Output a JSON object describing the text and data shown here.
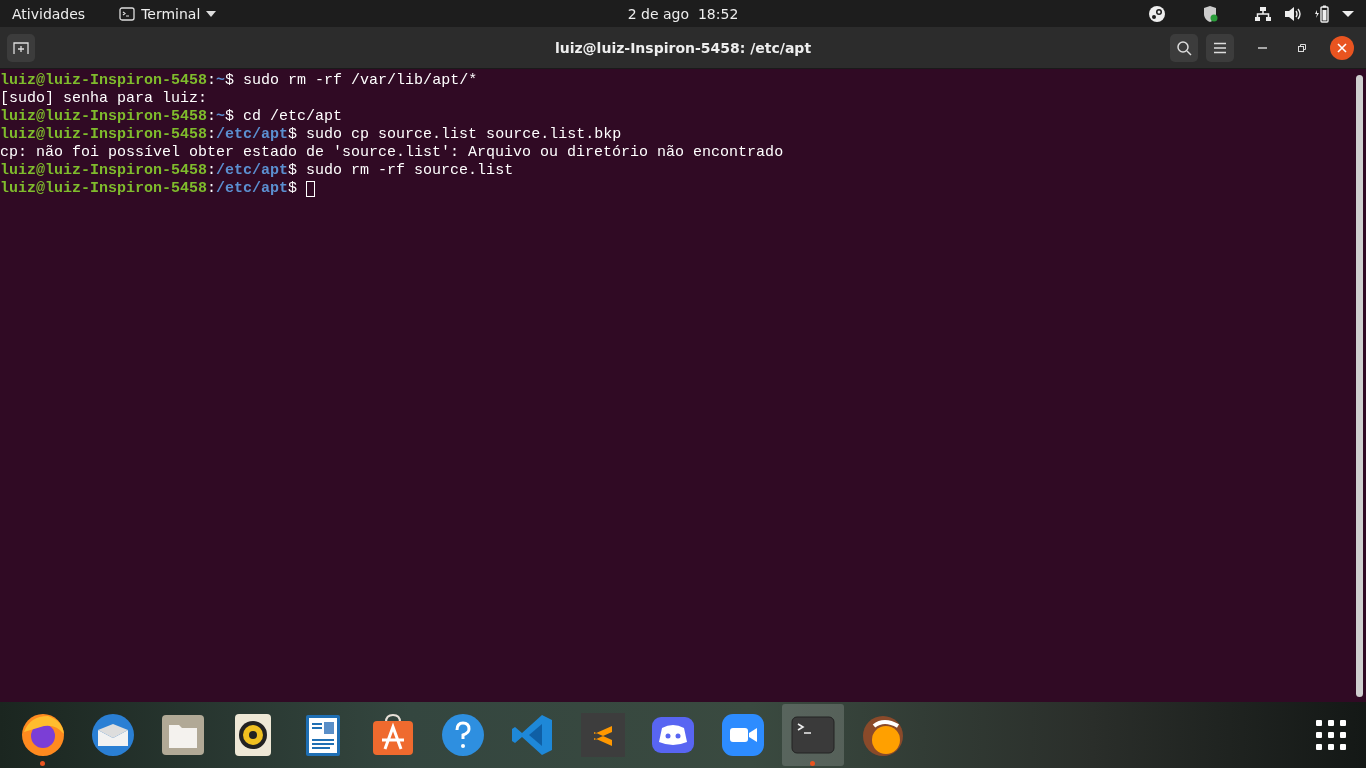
{
  "top_bar": {
    "activities": "Atividades",
    "app_menu": "Terminal",
    "clock": "2 de ago  18:52"
  },
  "window": {
    "title": "luiz@luiz-Inspiron-5458: /etc/apt"
  },
  "terminal_lines": [
    {
      "kind": "prompt",
      "user": "luiz@luiz-Inspiron-5458",
      "sep": ":",
      "path": "~",
      "sign": "$",
      "command": " sudo rm -rf /var/lib/apt/*",
      "cursor": false
    },
    {
      "kind": "output",
      "text": "[sudo] senha para luiz:"
    },
    {
      "kind": "prompt",
      "user": "luiz@luiz-Inspiron-5458",
      "sep": ":",
      "path": "~",
      "sign": "$",
      "command": " cd /etc/apt",
      "cursor": false
    },
    {
      "kind": "prompt",
      "user": "luiz@luiz-Inspiron-5458",
      "sep": ":",
      "path": "/etc/apt",
      "sign": "$",
      "command": " sudo cp source.list source.list.bkp",
      "cursor": false
    },
    {
      "kind": "output",
      "text": "cp: não foi possível obter estado de 'source.list': Arquivo ou diretório não encontrado"
    },
    {
      "kind": "prompt",
      "user": "luiz@luiz-Inspiron-5458",
      "sep": ":",
      "path": "/etc/apt",
      "sign": "$",
      "command": " sudo rm -rf source.list",
      "cursor": false
    },
    {
      "kind": "prompt",
      "user": "luiz@luiz-Inspiron-5458",
      "sep": ":",
      "path": "/etc/apt",
      "sign": "$",
      "cursor": true
    }
  ],
  "dock": [
    {
      "kind": "browser",
      "running": true,
      "selected": false
    },
    {
      "kind": "mail",
      "running": false,
      "selected": false
    },
    {
      "kind": "files",
      "running": false,
      "selected": false
    },
    {
      "kind": "music",
      "running": false,
      "selected": false
    },
    {
      "kind": "document",
      "running": false,
      "selected": false
    },
    {
      "kind": "store",
      "running": false,
      "selected": false
    },
    {
      "kind": "help",
      "running": false,
      "selected": false
    },
    {
      "kind": "code",
      "running": false,
      "selected": false
    },
    {
      "kind": "editor",
      "running": false,
      "selected": false
    },
    {
      "kind": "chat",
      "running": false,
      "selected": false
    },
    {
      "kind": "video",
      "running": false,
      "selected": false
    },
    {
      "kind": "terminal",
      "running": true,
      "selected": true
    },
    {
      "kind": "orange",
      "running": false,
      "selected": false
    }
  ]
}
